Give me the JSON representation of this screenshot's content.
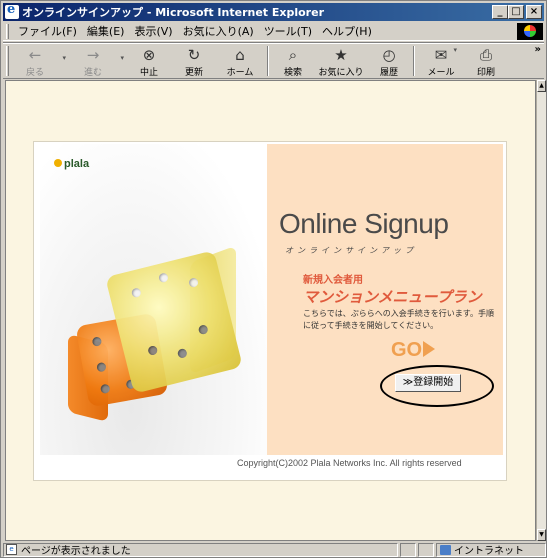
{
  "window": {
    "title": "オンラインサインアップ - Microsoft Internet Explorer",
    "minimize": "_",
    "maximize": "□",
    "close": "×"
  },
  "menu": {
    "items": [
      {
        "label": "ファイル(F)"
      },
      {
        "label": "編集(E)"
      },
      {
        "label": "表示(V)"
      },
      {
        "label": "お気に入り(A)"
      },
      {
        "label": "ツール(T)"
      },
      {
        "label": "ヘルプ(H)"
      }
    ]
  },
  "toolbar": {
    "back": {
      "label": "戻る",
      "icon": "back-arrow-icon"
    },
    "forward": {
      "label": "進む",
      "icon": "forward-arrow-icon"
    },
    "stop": {
      "label": "中止",
      "icon": "stop-icon"
    },
    "refresh": {
      "label": "更新",
      "icon": "refresh-icon"
    },
    "home": {
      "label": "ホーム",
      "icon": "home-icon"
    },
    "search": {
      "label": "検索",
      "icon": "search-icon"
    },
    "favorites": {
      "label": "お気に入り",
      "icon": "favorites-icon"
    },
    "history": {
      "label": "履歴",
      "icon": "history-icon"
    },
    "mail": {
      "label": "メール",
      "icon": "mail-icon"
    },
    "print": {
      "label": "印刷",
      "icon": "print-icon"
    },
    "more": "»"
  },
  "page": {
    "logo": "plala",
    "headline": "Online Signup",
    "headline_kana": "オンラインサインアップ",
    "new_member": "新規入会者用",
    "plan": "マンションメニュープラン",
    "description": "こちらでは、ぷららへの入会手続きを行います。手順に従って手続きを開始してください。",
    "go": "GO",
    "register_button": "≫登録開始",
    "copyright": "Copyright(C)2002 Plala Networks Inc. All rights reserved"
  },
  "status": {
    "message": "ページが表示されました",
    "zone": "イントラネット"
  },
  "colors": {
    "titlebar": "#0a246a",
    "content_bg": "#fbf5e1",
    "panel_bg": "#fde0c2",
    "accent": "#e05a3c"
  }
}
